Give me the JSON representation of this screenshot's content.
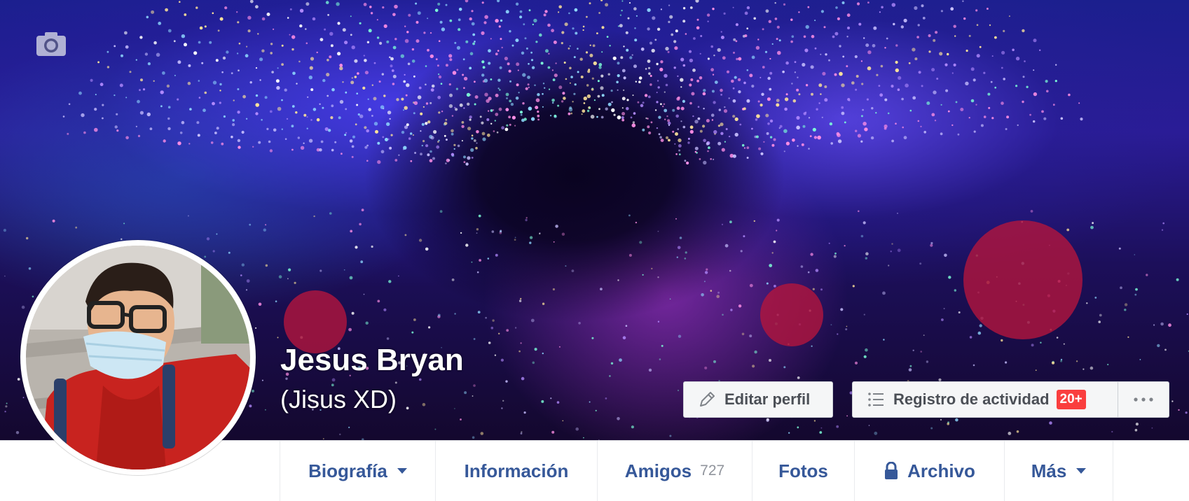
{
  "profile": {
    "name": "Jesus Bryan",
    "alternate_name": "(Jisus XD)"
  },
  "cover": {
    "camera_icon": "camera-icon"
  },
  "actions": {
    "edit_profile": {
      "icon": "pencil-icon",
      "label": "Editar perfil"
    },
    "activity_log": {
      "icon": "list-icon",
      "label": "Registro de actividad",
      "badge": "20+"
    },
    "more": {
      "icon": "more-dots-icon",
      "label": "···"
    }
  },
  "nav": {
    "tabs": [
      {
        "label": "Biografía",
        "has_caret": true
      },
      {
        "label": "Información"
      },
      {
        "label": "Amigos",
        "count": "727"
      },
      {
        "label": "Fotos"
      },
      {
        "label": "Archivo",
        "icon": "lock-icon"
      },
      {
        "label": "Más",
        "has_caret": true
      }
    ]
  },
  "colors": {
    "nav_link": "#365899",
    "badge": "#fa3e3e",
    "button_bg": "#f5f6f7",
    "count_gray": "#90949c"
  }
}
